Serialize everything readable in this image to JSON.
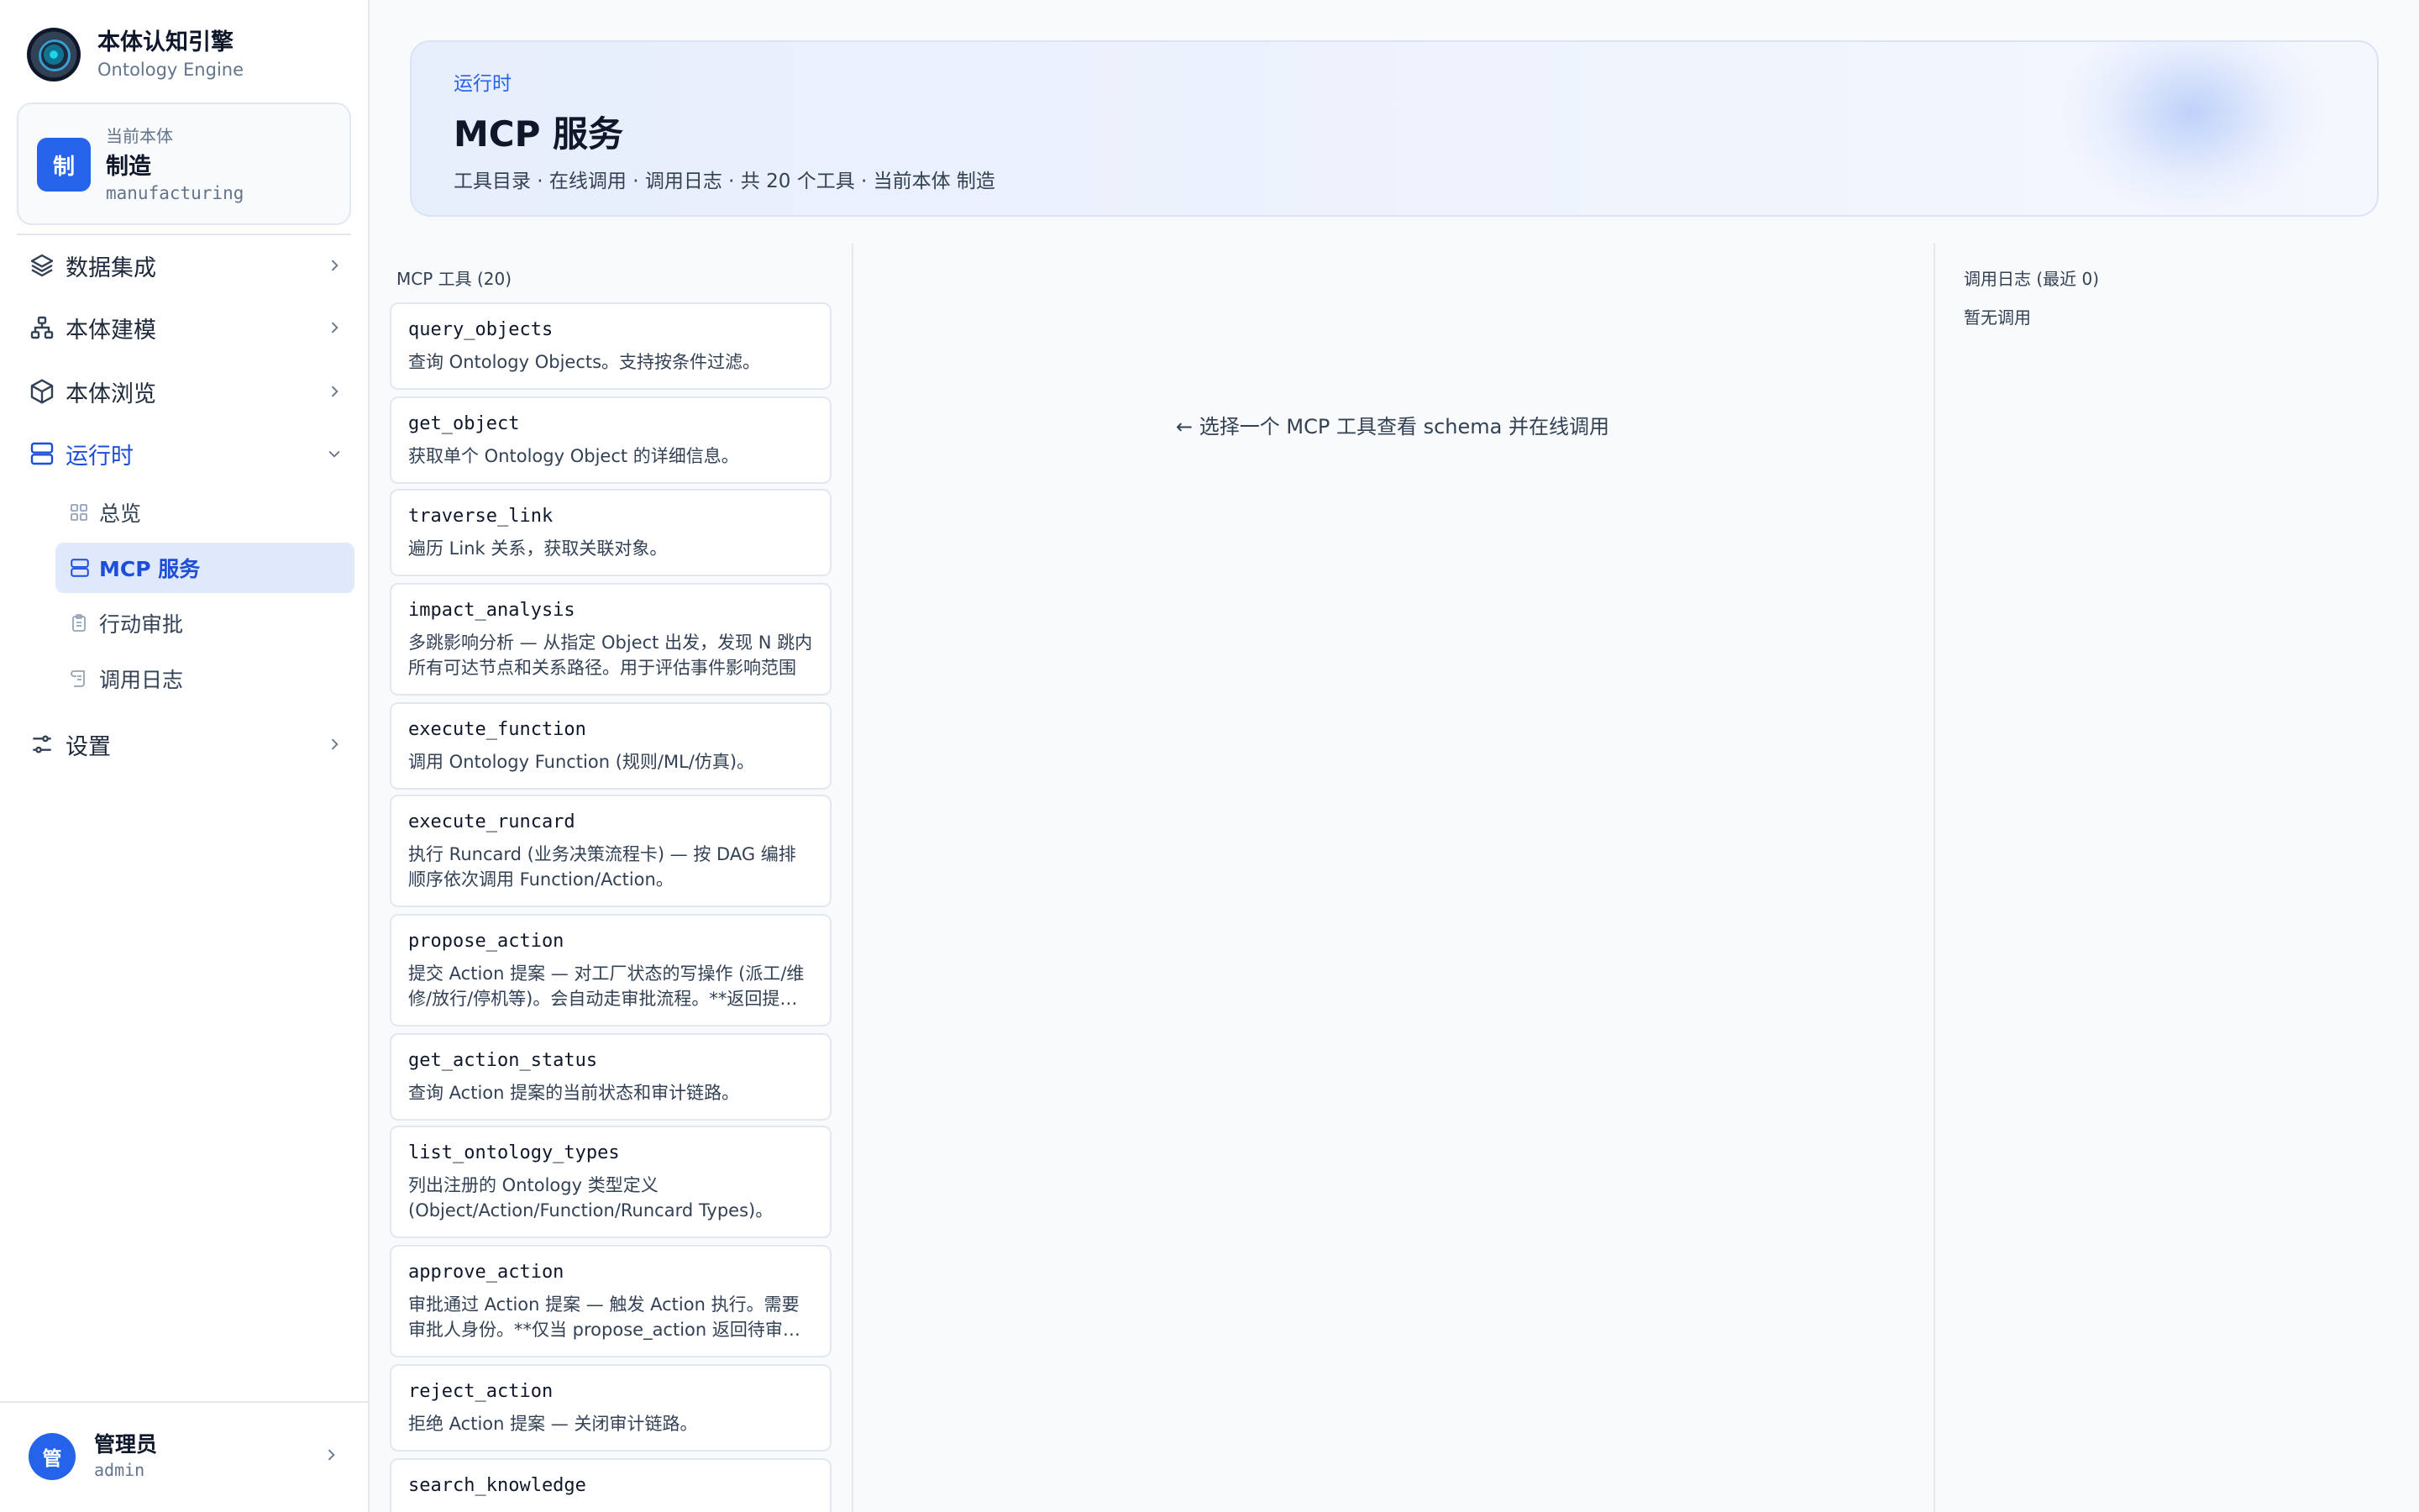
{
  "brand": {
    "title": "本体认知引擎",
    "subtitle": "Ontology Engine"
  },
  "current_ontology": {
    "label": "当前本体",
    "badge": "制",
    "name": "制造",
    "code": "manufacturing"
  },
  "nav": {
    "data_integration": "数据集成",
    "modeling": "本体建模",
    "browse": "本体浏览",
    "runtime": "运行时",
    "runtime_items": {
      "overview": "总览",
      "mcp": "MCP 服务",
      "approval": "行动审批",
      "logs": "调用日志"
    },
    "settings": "设置"
  },
  "user": {
    "avatar": "管",
    "name": "管理员",
    "id": "admin"
  },
  "header": {
    "eyebrow": "运行时",
    "title": "MCP 服务",
    "description": "工具目录 · 在线调用 · 调用日志 · 共 20 个工具 · 当前本体 制造"
  },
  "tools": {
    "heading": "MCP 工具 (20)",
    "items": [
      {
        "name": "query_objects",
        "desc": "查询 Ontology Objects。支持按条件过滤。"
      },
      {
        "name": "get_object",
        "desc": "获取单个 Ontology Object 的详细信息。"
      },
      {
        "name": "traverse_link",
        "desc": "遍历 Link 关系，获取关联对象。"
      },
      {
        "name": "impact_analysis",
        "desc": "多跳影响分析 — 从指定 Object 出发，发现 N 跳内所有可达节点和关系路径。用于评估事件影响范围"
      },
      {
        "name": "execute_function",
        "desc": "调用 Ontology Function (规则/ML/仿真)。"
      },
      {
        "name": "execute_runcard",
        "desc": "执行 Runcard (业务决策流程卡) — 按 DAG 编排顺序依次调用 Function/Action。"
      },
      {
        "name": "propose_action",
        "desc": "提交 Action 提案 — 对工厂状态的写操作 (派工/维修/放行/停机等)。会自动走审批流程。**返回提案编号"
      },
      {
        "name": "get_action_status",
        "desc": "查询 Action 提案的当前状态和审计链路。"
      },
      {
        "name": "list_ontology_types",
        "desc": "列出注册的 Ontology 类型定义 (Object/Action/Function/Runcard Types)。"
      },
      {
        "name": "approve_action",
        "desc": "审批通过 Action 提案 — 触发 Action 执行。需要审批人身份。**仅当 propose_action 返回待审批时使用"
      },
      {
        "name": "reject_action",
        "desc": "拒绝 Action 提案 — 关闭审计链路。"
      },
      {
        "name": "search_knowledge",
        "desc": ""
      }
    ]
  },
  "center": {
    "hint": "← 选择一个 MCP 工具查看 schema 并在线调用"
  },
  "logs": {
    "heading": "调用日志 (最近 0)",
    "empty": "暂无调用"
  },
  "colors": {
    "accent": "#2563eb",
    "active_bg": "#e0e9fb",
    "banner_bg": "#e7eefc"
  }
}
